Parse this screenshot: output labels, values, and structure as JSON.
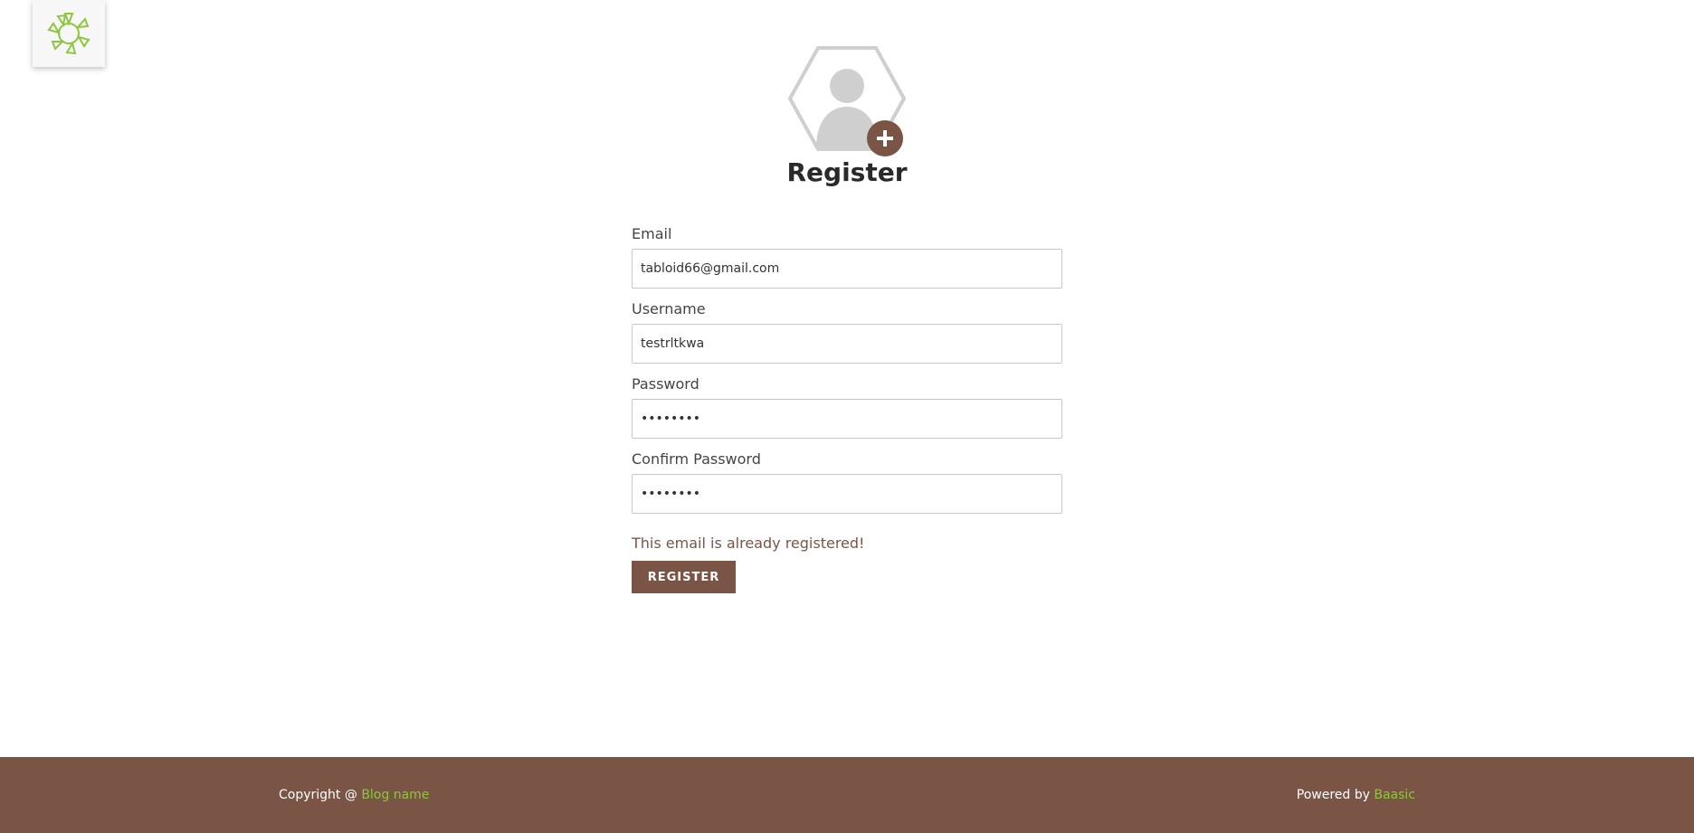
{
  "logo": {
    "icon": "sun-logo-icon",
    "color": "#8dc63f"
  },
  "avatar": {
    "icon": "user-avatar-icon",
    "add_icon": "plus-icon"
  },
  "page": {
    "title": "Register"
  },
  "form": {
    "email_label": "Email",
    "email_value": "tabloid66@gmail.com",
    "username_label": "Username",
    "username_value": "testrltkwa",
    "password_label": "Password",
    "password_value": "••••••••",
    "confirm_password_label": "Confirm Password",
    "confirm_password_value": "••••••••",
    "error_message": "This email is already registered!",
    "submit_label": "REGISTER"
  },
  "footer": {
    "copyright_prefix": "Copyright @ ",
    "blog_name": "Blog name",
    "powered_prefix": "Powered by ",
    "powered_link": "Baasic"
  },
  "colors": {
    "brand_brown": "#7a5546",
    "accent_green": "#8dc63f",
    "avatar_gray": "#cfcfcf"
  }
}
